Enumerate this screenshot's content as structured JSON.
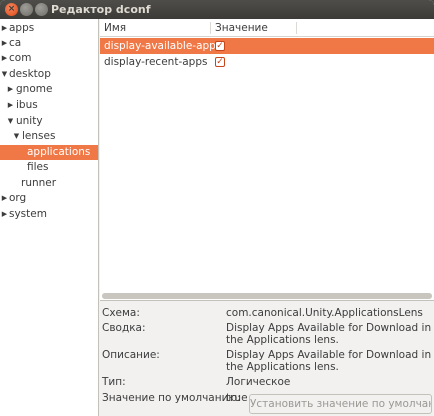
{
  "window": {
    "title": "Редактор dconf"
  },
  "tree": {
    "items": [
      {
        "label": "apps",
        "expanded": false
      },
      {
        "label": "ca",
        "expanded": false
      },
      {
        "label": "com",
        "expanded": false
      },
      {
        "label": "desktop",
        "expanded": true
      },
      {
        "label": "gnome",
        "expanded": false
      },
      {
        "label": "ibus",
        "expanded": false
      },
      {
        "label": "unity",
        "expanded": true
      },
      {
        "label": "lenses",
        "expanded": true
      },
      {
        "label": "applications",
        "selected": true
      },
      {
        "label": "files"
      },
      {
        "label": "runner"
      },
      {
        "label": "org",
        "expanded": false
      },
      {
        "label": "system",
        "expanded": false
      }
    ]
  },
  "list": {
    "headers": {
      "name": "Имя",
      "value": "Значение"
    },
    "rows": [
      {
        "name": "display-available-apps",
        "checked": true,
        "selected": true
      },
      {
        "name": "display-recent-apps",
        "checked": true,
        "selected": false
      }
    ]
  },
  "details": {
    "schema_label": "Схема:",
    "schema_value": "com.canonical.Unity.ApplicationsLens",
    "summary_label": "Сводка:",
    "summary_value": "Display Apps Available for Download in the Applications lens.",
    "description_label": "Описание:",
    "description_value": "Display Apps Available for Download in the Applications lens.",
    "type_label": "Тип:",
    "type_value": "Логическое",
    "default_label": "Значение по умолчанию:",
    "default_value": "true",
    "set_default_button": "Установить значение по умолчанию"
  },
  "colors": {
    "selection": "#f07746",
    "titlebar": "#3c3b37",
    "close_button": "#df4a16"
  }
}
